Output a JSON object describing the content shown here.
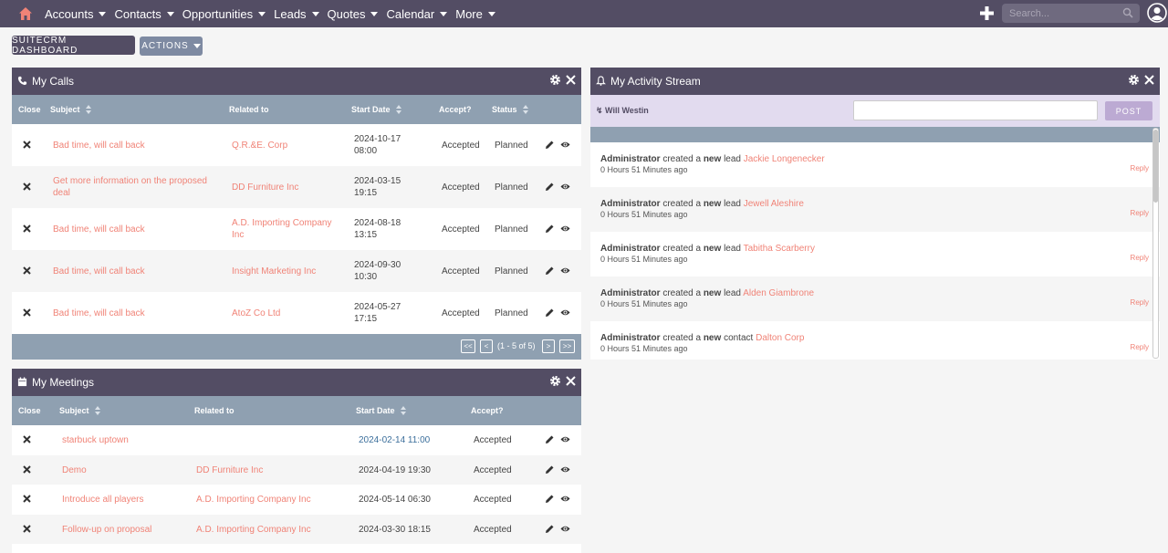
{
  "nav": {
    "items": [
      {
        "label": "Accounts"
      },
      {
        "label": "Contacts"
      },
      {
        "label": "Opportunities"
      },
      {
        "label": "Leads"
      },
      {
        "label": "Quotes"
      },
      {
        "label": "Calendar"
      },
      {
        "label": "More"
      }
    ],
    "search_placeholder": "Search..."
  },
  "toolbar": {
    "dashboard_label": "SUITECRM DASHBOARD",
    "actions_label": "ACTIONS"
  },
  "calls": {
    "title": "My Calls",
    "headers": {
      "close": "Close",
      "subject": "Subject",
      "related": "Related to",
      "start": "Start Date",
      "accept": "Accept?",
      "status": "Status"
    },
    "rows": [
      {
        "subject": "Bad time, will call back",
        "related": "Q.R.&E. Corp",
        "date": "2024-10-17",
        "time": "08:00",
        "accept": "Accepted",
        "status": "Planned"
      },
      {
        "subject": "Get more information on the proposed deal",
        "related": "DD Furniture Inc",
        "date": "2024-03-15",
        "time": "19:15",
        "accept": "Accepted",
        "status": "Planned"
      },
      {
        "subject": "Bad time, will call back",
        "related": "A.D. Importing Company Inc",
        "date": "2024-08-18",
        "time": "13:15",
        "accept": "Accepted",
        "status": "Planned"
      },
      {
        "subject": "Bad time, will call back",
        "related": "Insight Marketing Inc",
        "date": "2024-09-30",
        "time": "10:30",
        "accept": "Accepted",
        "status": "Planned"
      },
      {
        "subject": "Bad time, will call back",
        "related": "AtoZ Co Ltd",
        "date": "2024-05-27",
        "time": "17:15",
        "accept": "Accepted",
        "status": "Planned"
      }
    ],
    "pagination": {
      "first": "<<",
      "prev": "<",
      "info": "(1 - 5 of 5)",
      "next": ">",
      "last": ">>"
    }
  },
  "meetings": {
    "title": "My Meetings",
    "headers": {
      "close": "Close",
      "subject": "Subject",
      "related": "Related to",
      "start": "Start Date",
      "accept": "Accept?"
    },
    "rows": [
      {
        "subject": "starbuck uptown",
        "related": "",
        "start": "2024-02-14 11:00",
        "accept": "Accepted"
      },
      {
        "subject": "Demo",
        "related": "DD Furniture Inc",
        "start": "2024-04-19 19:30",
        "accept": "Accepted"
      },
      {
        "subject": "Introduce all players",
        "related": "A.D. Importing Company Inc",
        "start": "2024-05-14 06:30",
        "accept": "Accepted"
      },
      {
        "subject": "Follow-up on proposal",
        "related": "A.D. Importing Company Inc",
        "start": "2024-03-30 18:15",
        "accept": "Accepted"
      }
    ]
  },
  "activity": {
    "title": "My Activity Stream",
    "user": "Will Westin",
    "post_label": "POST",
    "items": [
      {
        "actor": "Administrator",
        "verb": "created a",
        "new": "new",
        "type": "lead",
        "target": "Jackie Longenecker",
        "time": "0 Hours 51 Minutes ago",
        "reply": "Reply"
      },
      {
        "actor": "Administrator",
        "verb": "created a",
        "new": "new",
        "type": "lead",
        "target": "Jewell Aleshire",
        "time": "0 Hours 51 Minutes ago",
        "reply": "Reply"
      },
      {
        "actor": "Administrator",
        "verb": "created a",
        "new": "new",
        "type": "lead",
        "target": "Tabitha Scarberry",
        "time": "0 Hours 51 Minutes ago",
        "reply": "Reply"
      },
      {
        "actor": "Administrator",
        "verb": "created a",
        "new": "new",
        "type": "lead",
        "target": "Alden Giambrone",
        "time": "0 Hours 51 Minutes ago",
        "reply": "Reply"
      },
      {
        "actor": "Administrator",
        "verb": "created a",
        "new": "new",
        "type": "contact",
        "target": "Dalton Corp",
        "time": "0 Hours 51 Minutes ago",
        "reply": "Reply"
      }
    ]
  },
  "colors": {
    "nav_bg": "#534d64",
    "table_header": "#8fa0b1",
    "link": "#f08377",
    "post_bar": "#e2dbef"
  },
  "icons": [
    "home-icon",
    "plus-icon",
    "search-icon",
    "user-avatar-icon",
    "phone-icon",
    "calendar-icon",
    "bell-icon",
    "gear-icon",
    "close-icon",
    "pencil-icon",
    "eye-icon",
    "remove-icon"
  ]
}
